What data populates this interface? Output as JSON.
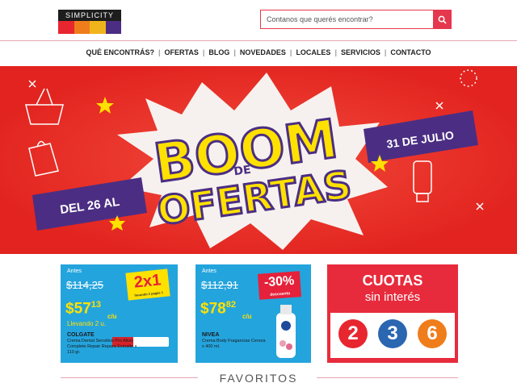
{
  "brand": {
    "logo_text": "SIMPLICITY",
    "bar_colors": [
      "#e8262f",
      "#ef7d1b",
      "#f1b51c",
      "#4b2e83"
    ]
  },
  "search": {
    "placeholder": "Contanos que querés encontrar?",
    "icon": "search-icon"
  },
  "nav": {
    "items": [
      "QUÉ ENCONTRÁS?",
      "OFERTAS",
      "BLOG",
      "NOVEDADES",
      "LOCALES",
      "SERVICIOS",
      "CONTACTO"
    ]
  },
  "banner": {
    "line1": "BOOM",
    "line2": "DE",
    "line3": "OFERTAS",
    "left_ribbon": "DEL 26 AL",
    "right_ribbon": "31 DE JULIO"
  },
  "cards": [
    {
      "antes_label": "Antes",
      "old_price": "$114,25",
      "badge": "2x1",
      "badge_note": "llevando 2 pagás 1",
      "new_price_int": "$57",
      "new_price_dec": "13",
      "unit": "c/u",
      "note": "Llevando 2 u.",
      "brand": "COLGATE",
      "description": "Crema Dental Sensitive Pro Alivio Complete Repair Repara Esmalte x 110 gr."
    },
    {
      "antes_label": "Antes",
      "old_price": "$112,91",
      "badge": "-30%",
      "badge_note": "descuento",
      "new_price_int": "$78",
      "new_price_dec": "82",
      "unit": "c/u",
      "brand": "NIVEA",
      "description": "Crema Body Fragancias Cereza x 400 ml."
    }
  ],
  "cuotas": {
    "title": "CUOTAS",
    "subtitle": "sin interés",
    "options": [
      {
        "label": "2",
        "color": "#e8262f"
      },
      {
        "label": "3",
        "color": "#2b66b1"
      },
      {
        "label": "6",
        "color": "#ef7d1b"
      }
    ]
  },
  "section": {
    "favorites_title": "FAVORITOS"
  },
  "colors": {
    "accent": "#e5384e",
    "banner_red": "#ec2e2b",
    "yellow": "#ffe100",
    "purple": "#4b2e83",
    "card_blue": "#24a4dd"
  }
}
